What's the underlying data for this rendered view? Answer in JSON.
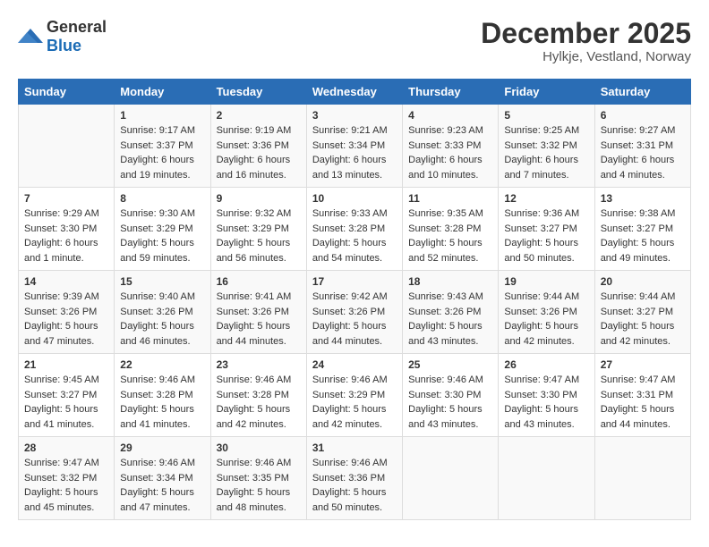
{
  "header": {
    "logo_general": "General",
    "logo_blue": "Blue",
    "title": "December 2025",
    "subtitle": "Hylkje, Vestland, Norway"
  },
  "days_of_week": [
    "Sunday",
    "Monday",
    "Tuesday",
    "Wednesday",
    "Thursday",
    "Friday",
    "Saturday"
  ],
  "weeks": [
    [
      {
        "day": "",
        "info": ""
      },
      {
        "day": "1",
        "info": "Sunrise: 9:17 AM\nSunset: 3:37 PM\nDaylight: 6 hours\nand 19 minutes."
      },
      {
        "day": "2",
        "info": "Sunrise: 9:19 AM\nSunset: 3:36 PM\nDaylight: 6 hours\nand 16 minutes."
      },
      {
        "day": "3",
        "info": "Sunrise: 9:21 AM\nSunset: 3:34 PM\nDaylight: 6 hours\nand 13 minutes."
      },
      {
        "day": "4",
        "info": "Sunrise: 9:23 AM\nSunset: 3:33 PM\nDaylight: 6 hours\nand 10 minutes."
      },
      {
        "day": "5",
        "info": "Sunrise: 9:25 AM\nSunset: 3:32 PM\nDaylight: 6 hours\nand 7 minutes."
      },
      {
        "day": "6",
        "info": "Sunrise: 9:27 AM\nSunset: 3:31 PM\nDaylight: 6 hours\nand 4 minutes."
      }
    ],
    [
      {
        "day": "7",
        "info": "Sunrise: 9:29 AM\nSunset: 3:30 PM\nDaylight: 6 hours\nand 1 minute."
      },
      {
        "day": "8",
        "info": "Sunrise: 9:30 AM\nSunset: 3:29 PM\nDaylight: 5 hours\nand 59 minutes."
      },
      {
        "day": "9",
        "info": "Sunrise: 9:32 AM\nSunset: 3:29 PM\nDaylight: 5 hours\nand 56 minutes."
      },
      {
        "day": "10",
        "info": "Sunrise: 9:33 AM\nSunset: 3:28 PM\nDaylight: 5 hours\nand 54 minutes."
      },
      {
        "day": "11",
        "info": "Sunrise: 9:35 AM\nSunset: 3:28 PM\nDaylight: 5 hours\nand 52 minutes."
      },
      {
        "day": "12",
        "info": "Sunrise: 9:36 AM\nSunset: 3:27 PM\nDaylight: 5 hours\nand 50 minutes."
      },
      {
        "day": "13",
        "info": "Sunrise: 9:38 AM\nSunset: 3:27 PM\nDaylight: 5 hours\nand 49 minutes."
      }
    ],
    [
      {
        "day": "14",
        "info": "Sunrise: 9:39 AM\nSunset: 3:26 PM\nDaylight: 5 hours\nand 47 minutes."
      },
      {
        "day": "15",
        "info": "Sunrise: 9:40 AM\nSunset: 3:26 PM\nDaylight: 5 hours\nand 46 minutes."
      },
      {
        "day": "16",
        "info": "Sunrise: 9:41 AM\nSunset: 3:26 PM\nDaylight: 5 hours\nand 44 minutes."
      },
      {
        "day": "17",
        "info": "Sunrise: 9:42 AM\nSunset: 3:26 PM\nDaylight: 5 hours\nand 44 minutes."
      },
      {
        "day": "18",
        "info": "Sunrise: 9:43 AM\nSunset: 3:26 PM\nDaylight: 5 hours\nand 43 minutes."
      },
      {
        "day": "19",
        "info": "Sunrise: 9:44 AM\nSunset: 3:26 PM\nDaylight: 5 hours\nand 42 minutes."
      },
      {
        "day": "20",
        "info": "Sunrise: 9:44 AM\nSunset: 3:27 PM\nDaylight: 5 hours\nand 42 minutes."
      }
    ],
    [
      {
        "day": "21",
        "info": "Sunrise: 9:45 AM\nSunset: 3:27 PM\nDaylight: 5 hours\nand 41 minutes."
      },
      {
        "day": "22",
        "info": "Sunrise: 9:46 AM\nSunset: 3:28 PM\nDaylight: 5 hours\nand 41 minutes."
      },
      {
        "day": "23",
        "info": "Sunrise: 9:46 AM\nSunset: 3:28 PM\nDaylight: 5 hours\nand 42 minutes."
      },
      {
        "day": "24",
        "info": "Sunrise: 9:46 AM\nSunset: 3:29 PM\nDaylight: 5 hours\nand 42 minutes."
      },
      {
        "day": "25",
        "info": "Sunrise: 9:46 AM\nSunset: 3:30 PM\nDaylight: 5 hours\nand 43 minutes."
      },
      {
        "day": "26",
        "info": "Sunrise: 9:47 AM\nSunset: 3:30 PM\nDaylight: 5 hours\nand 43 minutes."
      },
      {
        "day": "27",
        "info": "Sunrise: 9:47 AM\nSunset: 3:31 PM\nDaylight: 5 hours\nand 44 minutes."
      }
    ],
    [
      {
        "day": "28",
        "info": "Sunrise: 9:47 AM\nSunset: 3:32 PM\nDaylight: 5 hours\nand 45 minutes."
      },
      {
        "day": "29",
        "info": "Sunrise: 9:46 AM\nSunset: 3:34 PM\nDaylight: 5 hours\nand 47 minutes."
      },
      {
        "day": "30",
        "info": "Sunrise: 9:46 AM\nSunset: 3:35 PM\nDaylight: 5 hours\nand 48 minutes."
      },
      {
        "day": "31",
        "info": "Sunrise: 9:46 AM\nSunset: 3:36 PM\nDaylight: 5 hours\nand 50 minutes."
      },
      {
        "day": "",
        "info": ""
      },
      {
        "day": "",
        "info": ""
      },
      {
        "day": "",
        "info": ""
      }
    ]
  ]
}
